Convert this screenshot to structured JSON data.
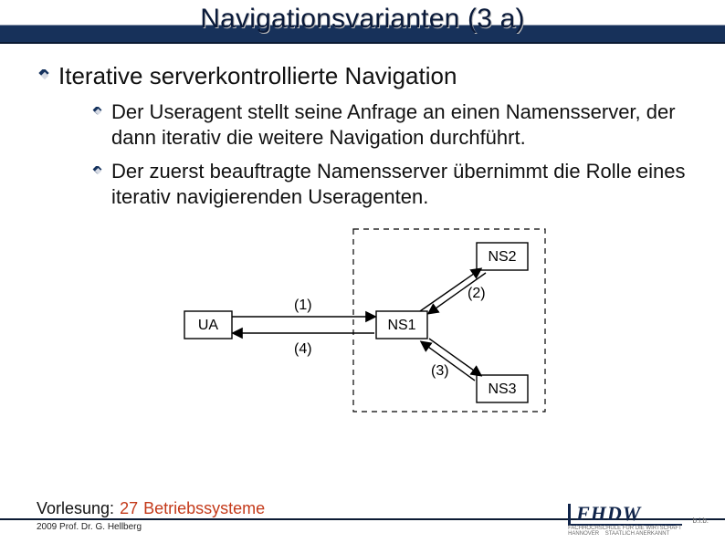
{
  "title": "Navigationsvarianten (3 a)",
  "main_bullet": "Iterative serverkontrollierte Navigation",
  "sub_bullets": [
    "Der Useragent stellt seine Anfrage an einen Namensserver, der dann iterativ die weitere Navigation durchführt.",
    "Der zuerst beauftragte Namensserver übernimmt die Rolle eines iterativ navigierenden Useragenten."
  ],
  "diagram": {
    "nodes": {
      "ua": "UA",
      "ns1": "NS1",
      "ns2": "NS2",
      "ns3": "NS3"
    },
    "edge_labels": {
      "e1": "(1)",
      "e2": "(2)",
      "e3": "(3)",
      "e4": "(4)"
    }
  },
  "footer": {
    "label": "Vorlesung:",
    "page": "27",
    "subject": "Betriebssysteme",
    "copyright": "2009 Prof. Dr. G. Hellberg"
  },
  "logo": {
    "main": "FHDW",
    "sub1": "FACHHOCHSCHULE FÜR DIE WIRTSCHAFT",
    "sub2": "HANNOVER",
    "sub3": "STAATLICH ANERKANNT",
    "bib": "b.i.b."
  }
}
